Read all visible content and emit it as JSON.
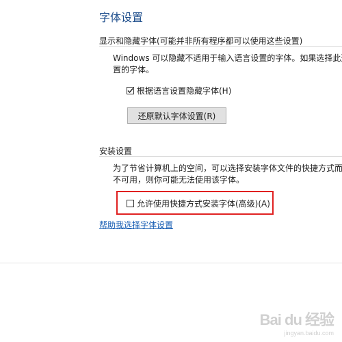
{
  "page_title": "字体设置",
  "show_hide_section": {
    "header": "显示和隐藏字体(可能并非所有程序都可以使用这些设置)",
    "description_line1": "Windows 可以隐藏不适用于输入语言设置的字体。如果选择此选",
    "description_line2": "置的字体。",
    "checkbox_label": "根据语言设置隐藏字体(H)",
    "checkbox_checked": true,
    "restore_button_label": "还原默认字体设置(R)"
  },
  "install_section": {
    "header": "安装设置",
    "description_line1": "为了节省计算机上的空间，可以选择安装字体文件的快捷方式而",
    "description_line2": "不可用，则你可能无法使用该字体。",
    "checkbox_label": "允许使用快捷方式安装字体(高级)(A)",
    "checkbox_checked": false
  },
  "help_link": "帮助我选择字体设置",
  "watermark": {
    "logo": "Bai du 经验",
    "url": "jingyan.baidu.com"
  },
  "colors": {
    "title": "#1e4e8c",
    "link": "#1a5fb4",
    "highlight": "#e02020"
  }
}
